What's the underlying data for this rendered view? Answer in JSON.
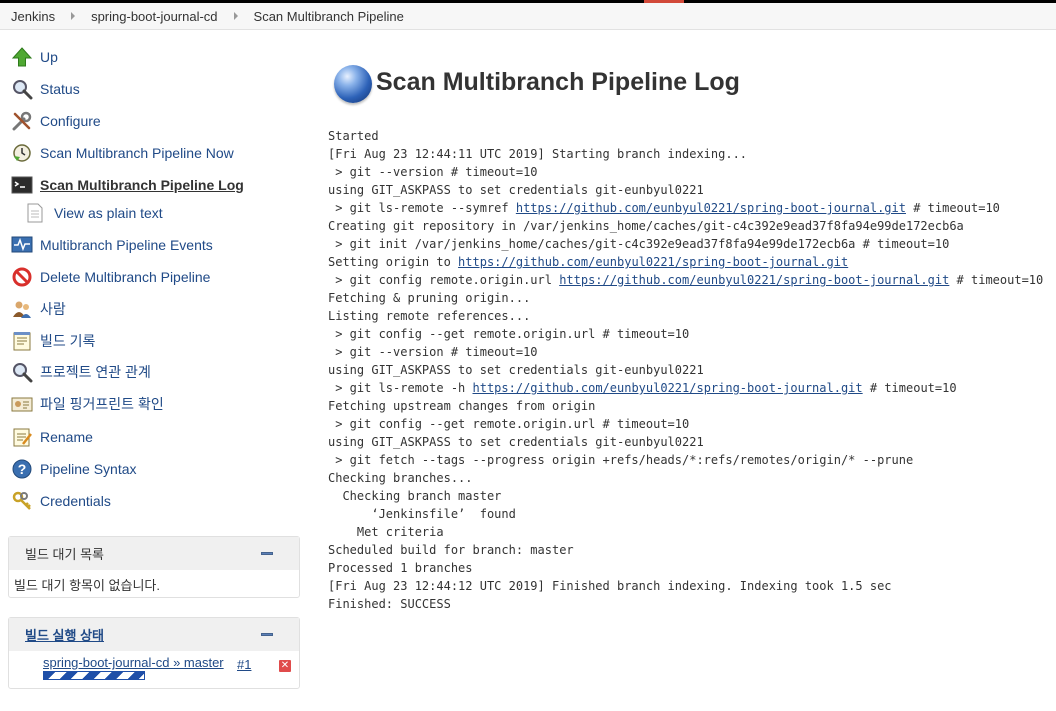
{
  "breadcrumbs": [
    "Jenkins",
    "spring-boot-journal-cd",
    "Scan Multibranch Pipeline"
  ],
  "sidebar": {
    "items": [
      {
        "label": "Up",
        "icon": "up-arrow-icon"
      },
      {
        "label": "Status",
        "icon": "magnifier-icon"
      },
      {
        "label": "Configure",
        "icon": "wrench-screwdriver-icon"
      },
      {
        "label": "Scan Multibranch Pipeline Now",
        "icon": "clock-refresh-icon"
      },
      {
        "label": "Scan Multibranch Pipeline Log",
        "icon": "terminal-icon"
      },
      {
        "label": "View as plain text",
        "icon": "document-icon"
      },
      {
        "label": "Multibranch Pipeline Events",
        "icon": "monitor-wave-icon"
      },
      {
        "label": "Delete Multibranch Pipeline",
        "icon": "no-entry-icon"
      },
      {
        "label": "사람",
        "icon": "people-icon"
      },
      {
        "label": "빌드 기록",
        "icon": "notepad-icon"
      },
      {
        "label": "프로젝트 연관 관계",
        "icon": "magnifier-icon"
      },
      {
        "label": "파일 핑거프린트 확인",
        "icon": "fingerprint-card-icon"
      },
      {
        "label": "Rename",
        "icon": "notepad-pencil-icon"
      },
      {
        "label": "Pipeline Syntax",
        "icon": "help-icon"
      },
      {
        "label": "Credentials",
        "icon": "keys-icon"
      }
    ]
  },
  "build_queue": {
    "title": "빌드 대기 목록",
    "empty_text": "빌드 대기 항목이 없습니다."
  },
  "executors": {
    "title": "빌드 실행 상태",
    "job": "spring-boot-journal-cd » master",
    "build_number": "#1",
    "progress": "indeterminate"
  },
  "main": {
    "title": "Scan Multibranch Pipeline Log",
    "repo_url": "https://github.com/eunbyul0221/spring-boot-journal.git",
    "log": [
      "Started",
      "[Fri Aug 23 12:44:11 UTC 2019] Starting branch indexing...",
      " > git --version # timeout=10",
      "using GIT_ASKPASS to set credentials git-eunbyul0221",
      " > git ls-remote --symref {url} # timeout=10",
      "Creating git repository in /var/jenkins_home/caches/git-c4c392e9ead37f8fa94e99de172ecb6a",
      " > git init /var/jenkins_home/caches/git-c4c392e9ead37f8fa94e99de172ecb6a # timeout=10",
      "Setting origin to {url}",
      " > git config remote.origin.url {url} # timeout=10",
      "Fetching & pruning origin...",
      "Listing remote references...",
      " > git config --get remote.origin.url # timeout=10",
      " > git --version # timeout=10",
      "using GIT_ASKPASS to set credentials git-eunbyul0221",
      " > git ls-remote -h {url} # timeout=10",
      "Fetching upstream changes from origin",
      " > git config --get remote.origin.url # timeout=10",
      "using GIT_ASKPASS to set credentials git-eunbyul0221",
      " > git fetch --tags --progress origin +refs/heads/*:refs/remotes/origin/* --prune",
      "Checking branches...",
      "  Checking branch master",
      "      ‘Jenkinsfile’  found",
      "    Met criteria",
      "Scheduled build for branch: master",
      "Processed 1 branches",
      "[Fri Aug 23 12:44:12 UTC 2019] Finished branch indexing. Indexing took 1.5 sec",
      "Finished: SUCCESS"
    ]
  },
  "colors": {
    "link": "#204a87",
    "accent_red": "#d24939",
    "progress": "#1f4fa8"
  }
}
